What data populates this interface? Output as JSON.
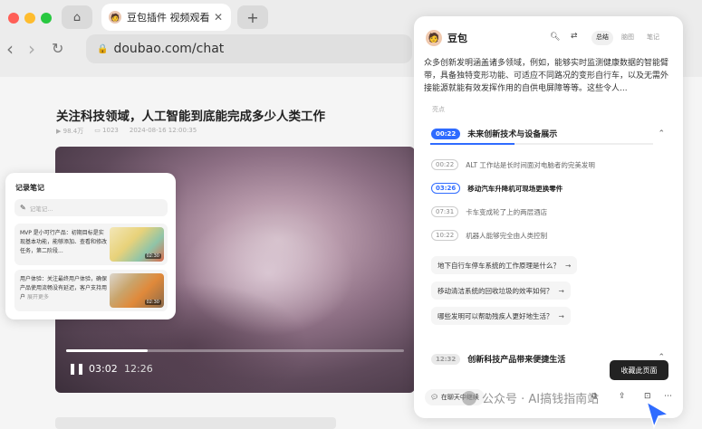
{
  "browser": {
    "tab_title": "豆包插件 视频观看",
    "tab_close": "✕",
    "new_tab": "+",
    "home_icon": "⌂",
    "url": "doubao.com/chat",
    "back": "‹",
    "forward": "›",
    "reload": "↻"
  },
  "article": {
    "title": "关注科技领域，人工智能到底能完成多少人类工作",
    "views": "98.4万",
    "comments": "1023",
    "date": "2024-08-16 12:00:35"
  },
  "video": {
    "current_time": "03:02",
    "total_time": "12:26",
    "progress": 0.24,
    "pause_icon": "❚❚"
  },
  "notes": {
    "title": "记录笔记",
    "placeholder": "记笔记...",
    "items": [
      {
        "text": "MVP 是小可行产品：初期目标是实现基本功能，能够添加、查看和修改任务，第二阶段...",
        "time": "02:30"
      },
      {
        "text": "用户体验：关注最终用户体验，确保产品使用流畅没有延迟，客户支持用户",
        "tag": "展开更多",
        "time": "02:30"
      }
    ]
  },
  "panel": {
    "avatar": "🧑",
    "title": "豆包",
    "tabs": [
      "总结",
      "脑图",
      "笔记"
    ],
    "active_tab": "总结",
    "summary": "众多创新发明涵盖诸多领域，例如，能够实时监测健康数据的智能臂带，具备独特变形功能、可适应不同路况的变形自行车，以及无需外接能源就能有效发挥作用的自供电屏障等等。这些令人...",
    "highlights_label": "亮点",
    "section1": {
      "time": "00:22",
      "title": "未来创新技术与设备展示",
      "progress": 0.38,
      "items": [
        {
          "time": "00:22",
          "text": "ALT 工作站是长时间面对电脑者的完美发明"
        },
        {
          "time": "03:26",
          "text": "移动汽车升降机可现场更换零件",
          "active": true
        },
        {
          "time": "07:31",
          "text": "卡车变成轮了上的两层酒店"
        },
        {
          "time": "10:22",
          "text": "机器人能够完全由人类控制"
        }
      ],
      "questions": [
        "地下自行车停车系统的工作原理是什么？",
        "移动清洁系统的回收垃圾的效率如何？",
        "哪些发明可以帮助残疾人更好地生活？"
      ]
    },
    "section2": {
      "time": "12:32",
      "title": "创新科技产品带来便捷生活"
    },
    "chat_button": "在聊天中继续"
  },
  "tooltip": "收藏此页面",
  "watermark": "公众号 · AI搞钱指南站",
  "colors": {
    "accent": "#2f6bff",
    "tooltip_bg": "#222222"
  }
}
